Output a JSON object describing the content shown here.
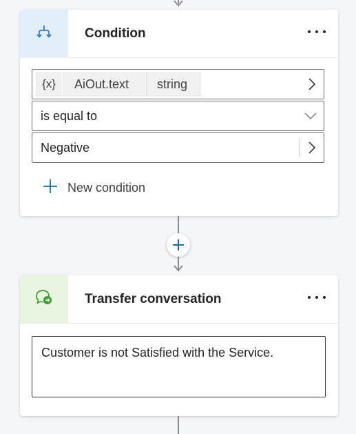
{
  "condition_node": {
    "title": "Condition",
    "variable": {
      "type_badge": "{x}",
      "name": "AiOut.text",
      "data_type": "string"
    },
    "operator": "is equal to",
    "value": "Negative",
    "add_condition_label": "New condition"
  },
  "transfer_node": {
    "title": "Transfer conversation",
    "message": "Customer is not Satisfied with the Service."
  },
  "colors": {
    "condition_icon_bg": "#e3eefb",
    "condition_icon": "#2f7fd0",
    "transfer_icon_bg": "#eaf5e1",
    "transfer_icon": "#3d9c2c",
    "accent": "#1271a9"
  },
  "icons": {
    "condition": "branch-icon",
    "transfer": "chat-transfer-icon",
    "menu": "more-icon",
    "add": "plus-icon"
  }
}
